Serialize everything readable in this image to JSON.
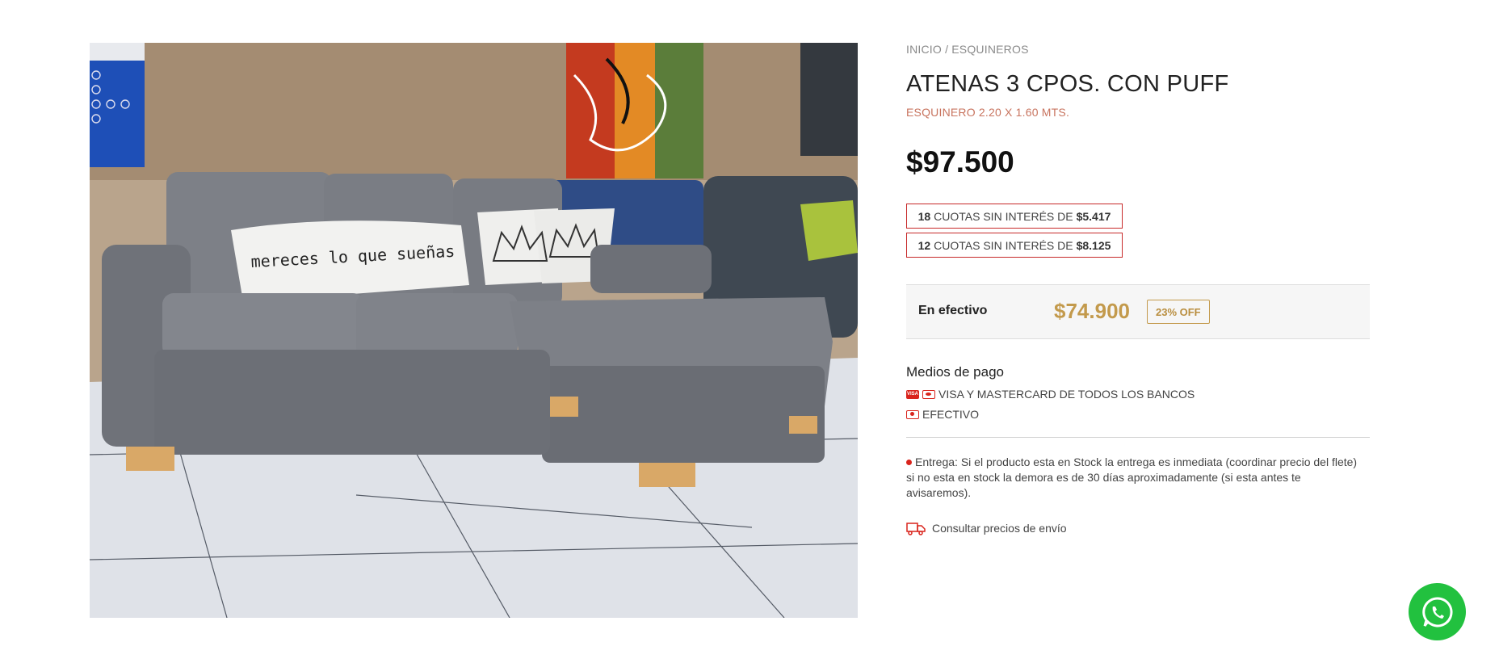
{
  "breadcrumb": {
    "home": "INICIO",
    "separator": "/",
    "category": "ESQUINEROS"
  },
  "product": {
    "title": "ATENAS 3 CPOS. CON PUFF",
    "subtitle": "ESQUINERO 2.20 X 1.60 MTS.",
    "price": "$97.500",
    "image_alt": "Sofá esquinero gris con puff",
    "pillow_text": "mereces lo que sueñas"
  },
  "installments": [
    {
      "count": "18",
      "label": "CUOTAS SIN INTERÉS DE",
      "amount": "$5.417"
    },
    {
      "count": "12",
      "label": "CUOTAS SIN INTERÉS DE",
      "amount": "$8.125"
    }
  ],
  "cash": {
    "label": "En efectivo",
    "price": "$74.900",
    "discount": "23% OFF"
  },
  "payment": {
    "title": "Medios de pago",
    "methods": [
      {
        "icon": "credit-card-icon",
        "label": "VISA Y MASTERCARD DE TODOS LOS BANCOS"
      },
      {
        "icon": "cash-icon",
        "label": "EFECTIVO"
      }
    ]
  },
  "delivery_note": "Entrega: Si el producto esta en Stock la entrega es inmediata (coordinar precio del flete) si no esta en stock la demora es de 30 días aproximadamente (si esta antes te avisaremos).",
  "shipping_link": "Consultar precios de envío",
  "colors": {
    "accent_red": "#d9241c",
    "gold": "#c39a4c",
    "subtitle": "#c8745f",
    "whatsapp": "#22c13f"
  },
  "icons": {
    "shipping": "truck-icon",
    "whatsapp": "whatsapp-icon"
  }
}
